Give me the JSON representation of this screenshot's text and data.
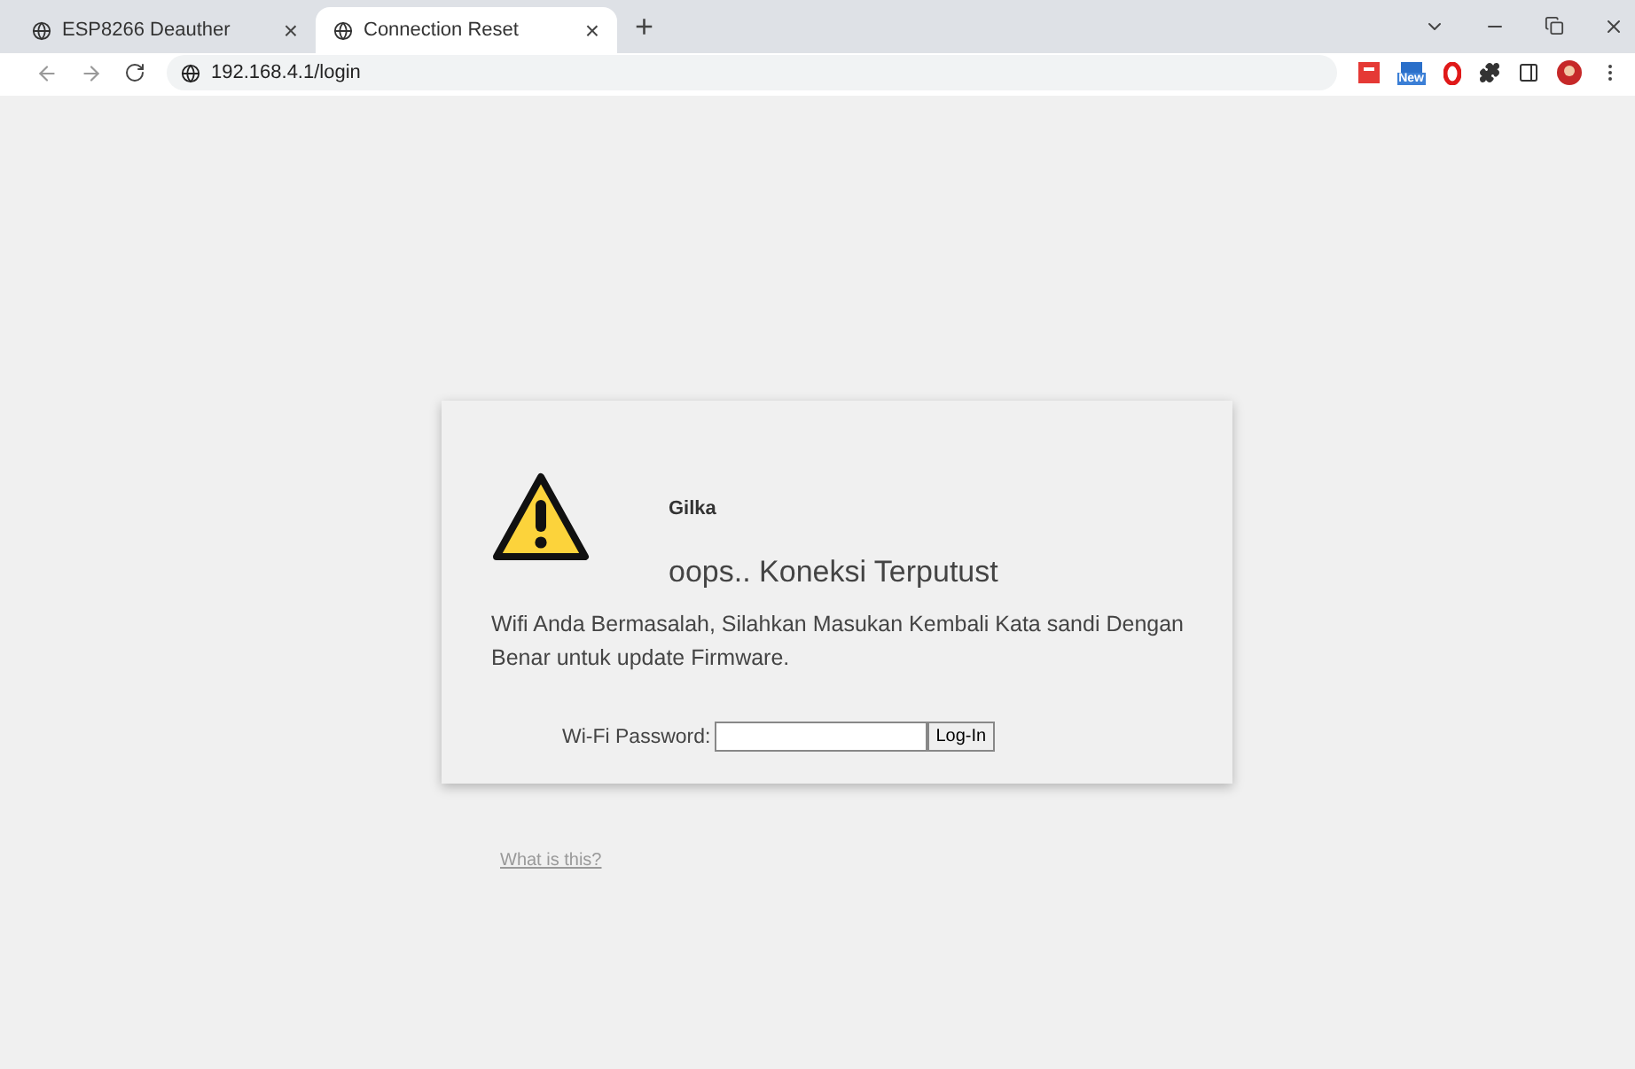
{
  "tabs": [
    {
      "title": "ESP8266 Deauther",
      "close": "×",
      "selected": false
    },
    {
      "title": "Connection Reset",
      "close": "×",
      "selected": true
    }
  ],
  "new_tab": "+",
  "address": "192.168.4.1/login",
  "extension_badge": "New",
  "card": {
    "brand": "Gilka",
    "heading": "oops.. Koneksi Terputust",
    "message": "Wifi Anda Bermasalah, Silahkan Masukan Kembali Kata sandi Dengan Benar untuk update Firmware.",
    "password_label": "Wi-Fi Password:",
    "button": "Log-In"
  },
  "help_link": "What is this?"
}
